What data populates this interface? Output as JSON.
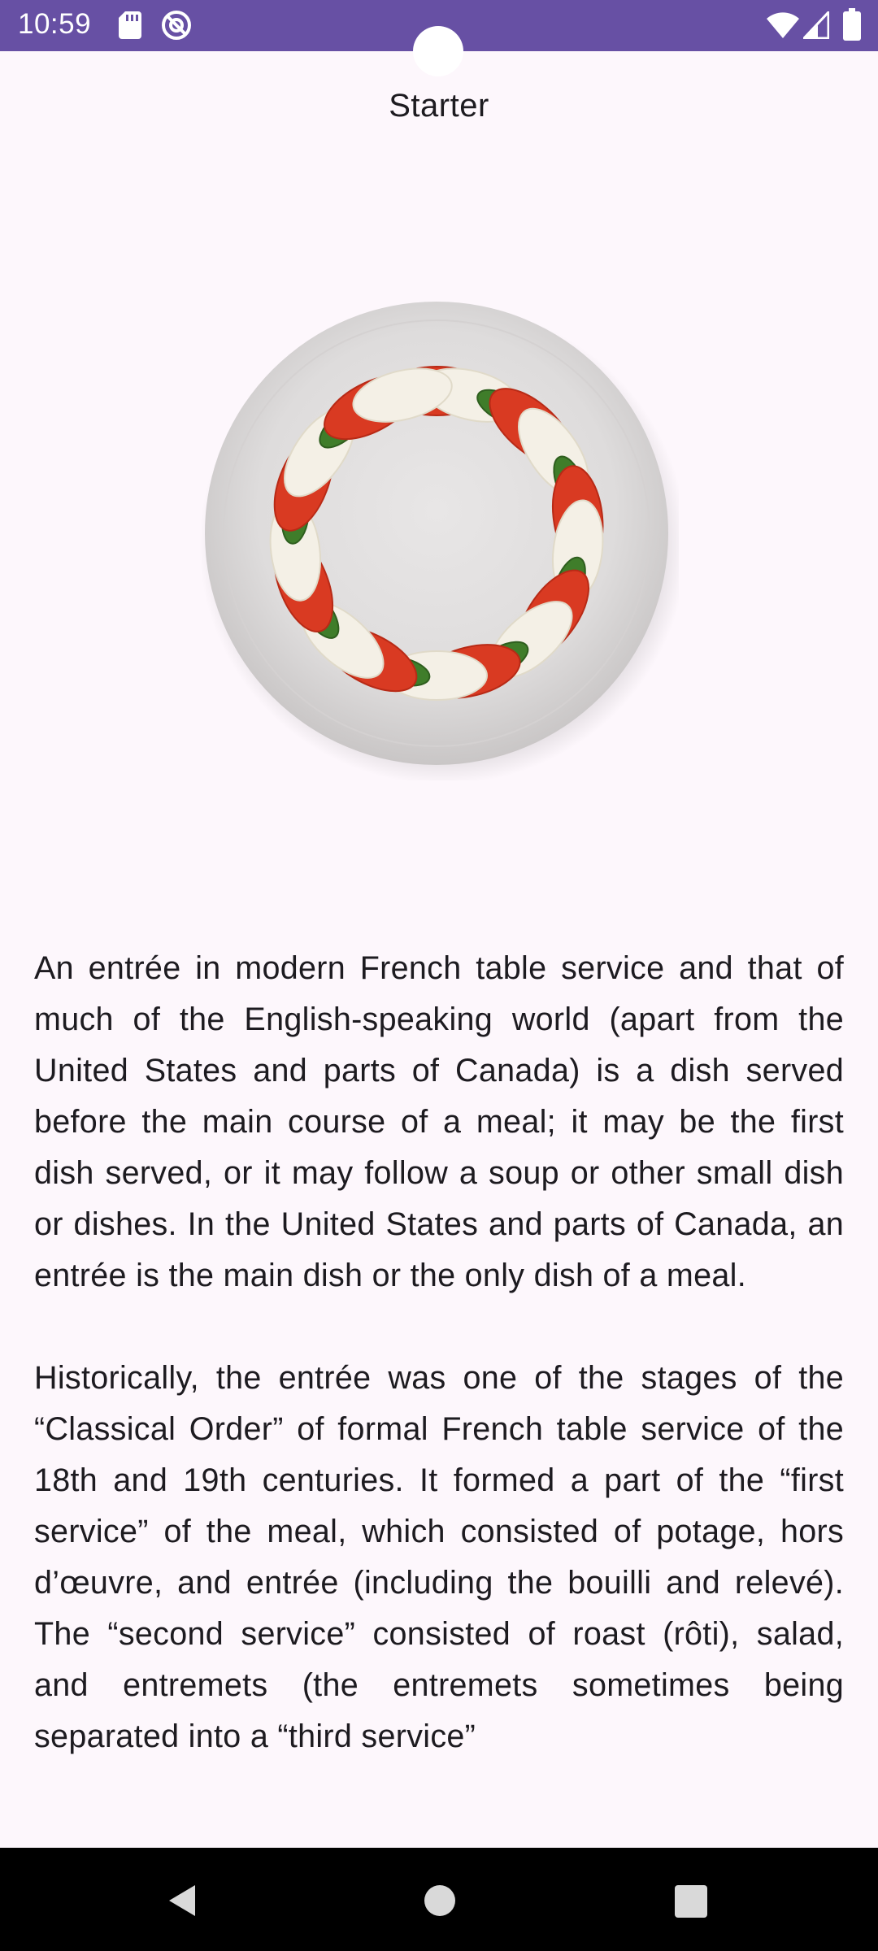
{
  "status_bar": {
    "time": "10:59",
    "background": "#6750a4",
    "icons": [
      "sd-card-icon",
      "do-not-disturb-icon",
      "wifi-icon",
      "cellular-signal-icon",
      "battery-icon"
    ]
  },
  "header": {
    "title": "Starter"
  },
  "image": {
    "subject": "caprese salad ring on white plate"
  },
  "article": {
    "paragraphs": [
      "An entrée in modern French table service and that of much of the English-speaking world (apart from the United States and parts of Canada) is a dish served before the main course of a meal; it may be the first dish served, or it may follow a soup or other small dish or dishes. In the United States and parts of Canada, an entrée is the main dish or the only dish of a meal.",
      "Historically, the entrée was one of the stages of the “Classical Order” of formal French table service of the 18th and 19th centuries. It formed a part of the “first service” of the meal, which consisted of potage, hors d’œuvre, and entrée (including the bouilli and relevé). The “second service” consisted of roast (rôti), salad, and entremets (the entremets sometimes being separated into a “third service”"
    ]
  },
  "nav_bar": {
    "buttons": [
      "back",
      "home",
      "recents"
    ]
  }
}
